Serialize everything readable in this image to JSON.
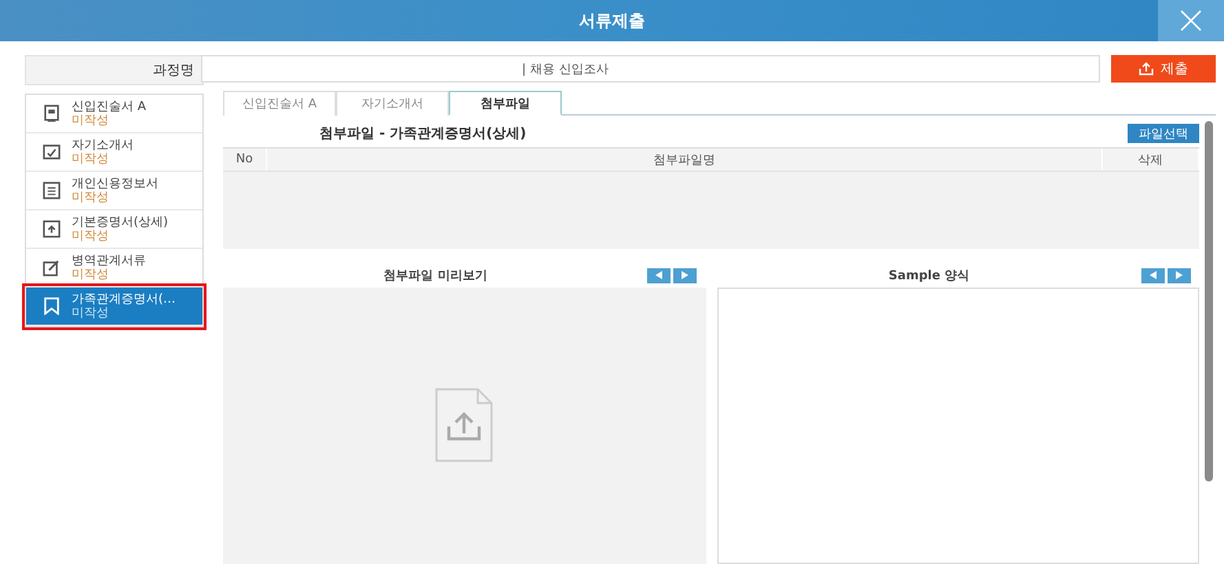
{
  "window": {
    "title": "서류제출"
  },
  "course": {
    "label": "과정명",
    "value": "| 채용 신입조사"
  },
  "submit_button": {
    "label": "제출"
  },
  "sidebar": {
    "items": [
      {
        "title": "신입진술서 A",
        "status": "미작성",
        "selected": false
      },
      {
        "title": "자기소개서",
        "status": "미작성",
        "selected": false
      },
      {
        "title": "개인신용정보서",
        "status": "미작성",
        "selected": false
      },
      {
        "title": "기본증명서(상세)",
        "status": "미작성",
        "selected": false
      },
      {
        "title": "병역관계서류",
        "status": "미작성",
        "selected": false
      },
      {
        "title": "가족관계증명서(…",
        "status": "미작성",
        "selected": true
      }
    ]
  },
  "tabs": [
    {
      "label": "신입진술서 A",
      "selected": false
    },
    {
      "label": "자기소개서",
      "selected": false
    },
    {
      "label": "첨부파일",
      "selected": true
    }
  ],
  "attachments": {
    "title": "첨부파일 - 가족관계증명서(상세)",
    "select_button": "파일선택",
    "columns": [
      "No",
      "첨부파일명",
      "삭제"
    ]
  },
  "preview": {
    "title": "첨부파일 미리보기"
  },
  "sample": {
    "title": "Sample 양식"
  }
}
